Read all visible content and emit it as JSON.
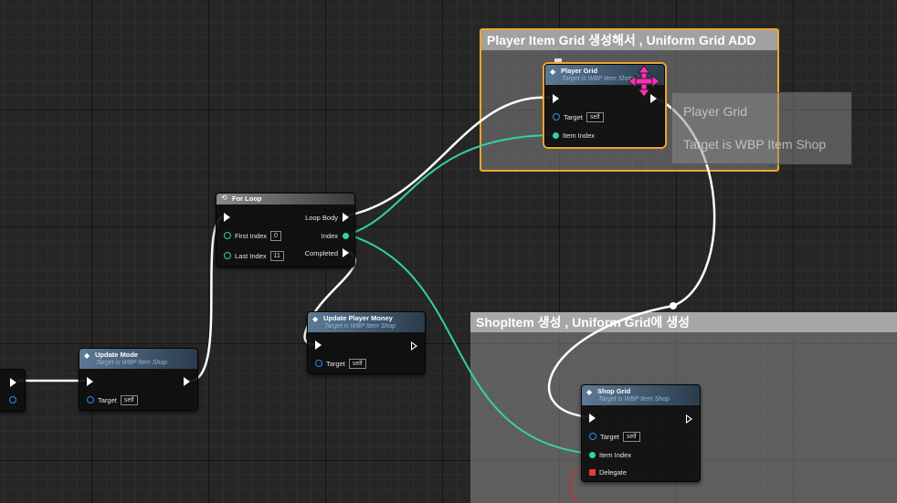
{
  "colors": {
    "grid_bg": "#262626",
    "exec_wire": "#ffffff",
    "int_wire": "#33d1a8",
    "object_pin": "#2f8fe8",
    "delegate_pin": "#e43b3b",
    "selection": "#f1a52b",
    "move_cursor": "#ff2fb6"
  },
  "comments": {
    "player": {
      "title": "Player Item Grid 생성해서 , Uniform Grid ADD"
    },
    "shop": {
      "title": "ShopItem 생성 , Uniform Grid에 생성"
    }
  },
  "nodes": {
    "for_loop": {
      "title": "For Loop",
      "loop_body": "Loop Body",
      "first_index": "First Index",
      "first_index_value": "0",
      "last_index": "Last Index",
      "last_index_value": "11",
      "index": "Index",
      "completed": "Completed"
    },
    "update_mode": {
      "title": "Update Mode",
      "subtitle": "Target is WBP Item Shop",
      "target": "Target",
      "target_value": "self"
    },
    "update_player_money": {
      "title": "Update Player Money",
      "subtitle": "Target is WBP Item Shop",
      "target": "Target",
      "target_value": "self"
    },
    "player_grid": {
      "title": "Player Grid",
      "subtitle": "Target is WBP Item Shop",
      "target": "Target",
      "target_value": "self",
      "item_index": "Item Index"
    },
    "shop_grid": {
      "title": "Shop Grid",
      "subtitle": "Target is WBP Item Shop",
      "target": "Target",
      "target_value": "self",
      "item_index": "Item Index",
      "delegate": "Delegate"
    }
  },
  "tooltip": {
    "line1": "Player Grid",
    "line2": "Target is WBP Item Shop"
  },
  "icons": {
    "function": "function-icon",
    "loop": "loop-icon",
    "move": "move-arrows-icon"
  }
}
